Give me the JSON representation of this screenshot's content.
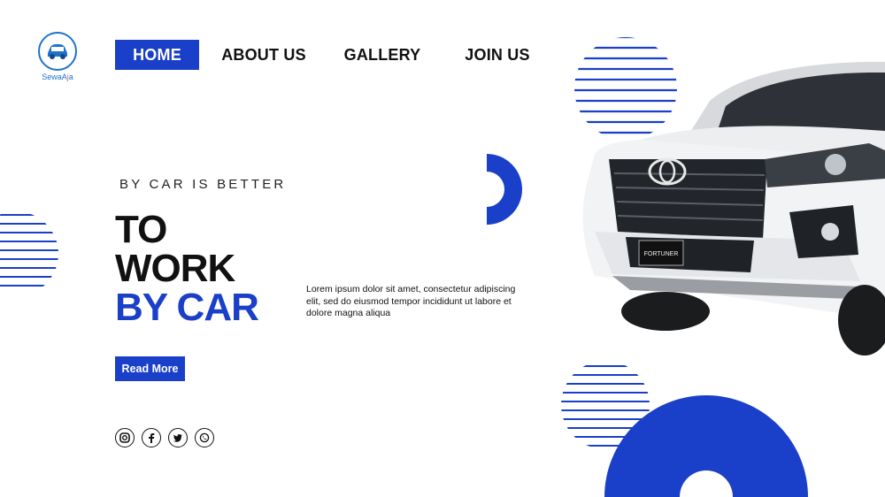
{
  "brand": {
    "name_main": "SewaA",
    "name_accent": "j",
    "name_tail": "a"
  },
  "nav": {
    "items": [
      {
        "label": "HOME",
        "active": true
      },
      {
        "label": "ABOUT US",
        "active": false
      },
      {
        "label": "GALLERY",
        "active": false
      },
      {
        "label": "JOIN US",
        "active": false
      }
    ]
  },
  "hero": {
    "tagline": "BY CAR IS BETTER",
    "headline": [
      "TO",
      "WORK",
      "BY CAR"
    ],
    "description": "Lorem ipsum dolor sit amet, consectetur adipiscing elit, sed do eiusmod tempor incididunt ut labore et dolore magna aliqua",
    "cta_label": "Read More"
  },
  "social": [
    {
      "icon": "instagram-icon",
      "glyph": "◘"
    },
    {
      "icon": "facebook-icon",
      "glyph": "f"
    },
    {
      "icon": "twitter-icon",
      "glyph": "t"
    },
    {
      "icon": "whatsapp-icon",
      "glyph": "✆"
    }
  ],
  "car": {
    "badge_text": "FORTUNER"
  },
  "colors": {
    "accent": "#1a3fc8",
    "logo_blue": "#1e73c8",
    "text": "#111111"
  }
}
